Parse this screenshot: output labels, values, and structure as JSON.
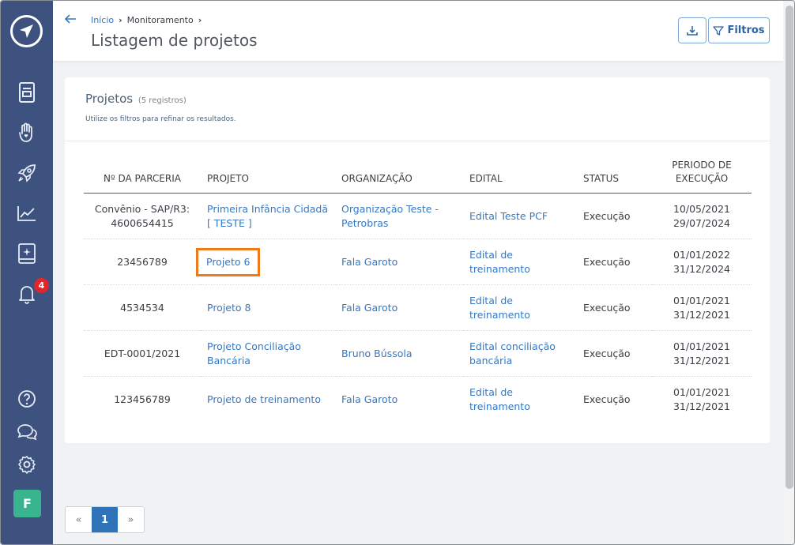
{
  "sidebar": {
    "notification_count": "4",
    "avatar_letter": "F"
  },
  "header": {
    "breadcrumb": [
      "Início",
      "Monitoramento"
    ],
    "title": "Listagem de projetos",
    "filter_label": "Filtros"
  },
  "card": {
    "title": "Projetos",
    "count": "(5 registros)",
    "subtitle": "Utilize os filtros para refinar os resultados."
  },
  "table": {
    "headers": [
      "Nº DA PARCERIA",
      "PROJETO",
      "ORGANIZAÇÃO",
      "EDITAL",
      "STATUS",
      "PERIODO DE EXECUÇÃO"
    ],
    "rows": [
      {
        "parceria": "Convênio - SAP/R3: 4600654415",
        "projeto": "Primeira Infância Cidadã [ TESTE ]",
        "organizacao": "Organização Teste - Petrobras",
        "edital": "Edital Teste PCF",
        "status": "Execução",
        "inicio": "10/05/2021",
        "fim": "29/07/2024"
      },
      {
        "parceria": "23456789",
        "projeto": "Projeto 6",
        "organizacao": "Fala Garoto",
        "edital": "Edital de treinamento",
        "status": "Execução",
        "inicio": "01/01/2022",
        "fim": "31/12/2024"
      },
      {
        "parceria": "4534534",
        "projeto": "Projeto 8",
        "organizacao": "Fala Garoto",
        "edital": "Edital de treinamento",
        "status": "Execução",
        "inicio": "01/01/2021",
        "fim": "31/12/2021"
      },
      {
        "parceria": "EDT-0001/2021",
        "projeto": "Projeto Conciliação Bancária",
        "organizacao": "Bruno Bússola",
        "edital": "Edital conciliação bancária",
        "status": "Execução",
        "inicio": "01/01/2021",
        "fim": "31/12/2021"
      },
      {
        "parceria": "123456789",
        "projeto": "Projeto de treinamento",
        "organizacao": "Fala Garoto",
        "edital": "Edital de treinamento",
        "status": "Execução",
        "inicio": "01/01/2021",
        "fim": "31/12/2021"
      }
    ]
  },
  "pagination": {
    "prev": "«",
    "current": "1",
    "next": "»"
  }
}
